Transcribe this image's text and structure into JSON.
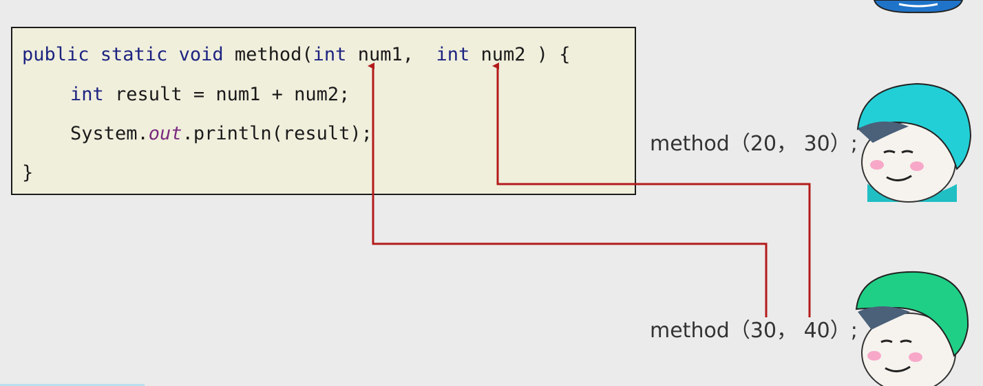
{
  "code": {
    "line1": {
      "kw1": "public static void",
      "mid1": " method(",
      "kw2": "int",
      "mid2": " num1,  ",
      "kw3": "int",
      "mid3": " num2 ) {"
    },
    "line2": {
      "kw": "int",
      "rest": " result = num1 + num2;"
    },
    "line3": {
      "pre": "System.",
      "field": "out",
      "post": ".println(result);"
    },
    "line4": "}"
  },
  "calls": [
    {
      "text": "method（20， 30）;"
    },
    {
      "text": "method（30， 40）;"
    }
  ],
  "colors": {
    "arrow": "#b31b1b",
    "helmet_top": "#22cfd6",
    "helmet_bottom": "#1fcf86",
    "code_bg": "#f0efdc"
  },
  "icons": [
    "helmet-avatar-icon",
    "helmet-avatar-icon",
    "helmet-avatar-icon"
  ]
}
